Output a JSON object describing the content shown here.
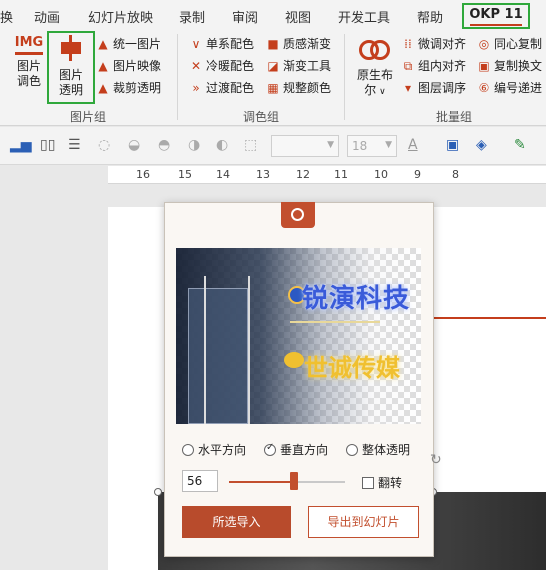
{
  "tabs": [
    "换",
    "动画",
    "幻灯片放映",
    "录制",
    "审阅",
    "视图",
    "开发工具",
    "帮助",
    "OKP 11"
  ],
  "ribbon": {
    "img_icon_text": "IMG",
    "color_btn": [
      "图片",
      "调色"
    ],
    "trans_btn": [
      "图片",
      "透明"
    ],
    "pic_items": [
      "统一图片",
      "图片映像",
      "裁剪透明"
    ],
    "pic_group": "图片组",
    "color_col1": [
      "单系配色",
      "冷暖配色",
      "过渡配色"
    ],
    "color_col2": [
      "质感渐变",
      "渐变工具",
      "规整颜色"
    ],
    "color_group": "调色组",
    "gen_btn": [
      "原生布",
      "尔"
    ],
    "batch_col1": [
      "微调对齐",
      "组内对齐",
      "图层调序"
    ],
    "batch_col2": [
      "同心复制",
      "复制换文",
      "编号递进"
    ],
    "batch_group": "批量组"
  },
  "toolbar": {
    "font_size": "18"
  },
  "ruler": [
    "16",
    "15",
    "14",
    "13",
    "12",
    "11",
    "10",
    "9",
    "8"
  ],
  "panel": {
    "preview_text1": "锐演科技",
    "preview_text2": "世诚传媒",
    "options": [
      "水平方向",
      "垂直方向",
      "整体透明"
    ],
    "selected_option": "垂直方向",
    "value": "56",
    "value_pct": 56,
    "flip_label": "翻转",
    "import_btn": "所选导入",
    "export_btn": "导出到幻灯片"
  },
  "colors": {
    "accent": "#c24f2e",
    "okp_border": "#2fa83b"
  }
}
